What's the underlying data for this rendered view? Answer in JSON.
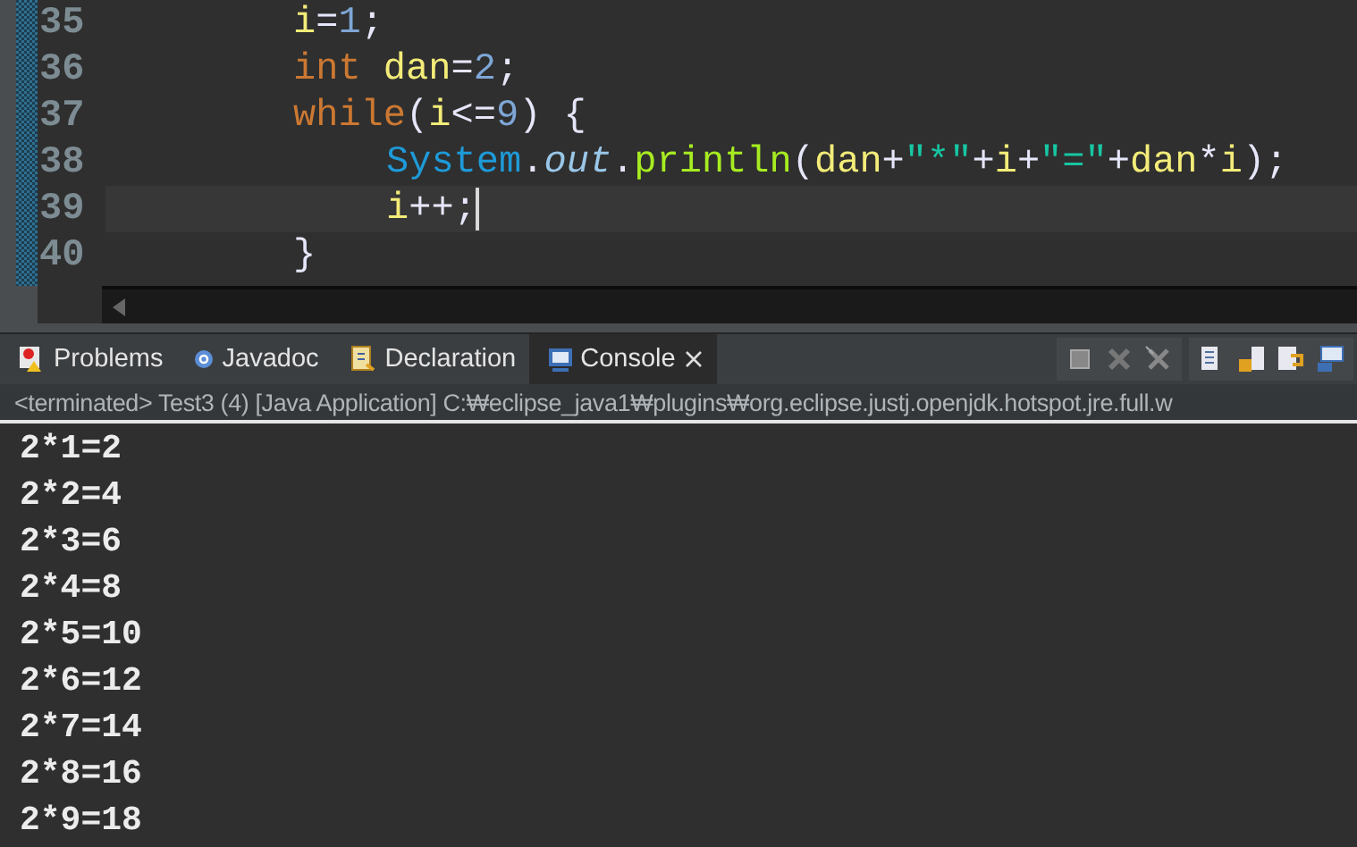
{
  "editor": {
    "lines": [
      {
        "number": "35",
        "current": false,
        "tokens": [
          {
            "text": "i",
            "kind": "var"
          },
          {
            "text": "=",
            "kind": "op"
          },
          {
            "text": "1",
            "kind": "number"
          },
          {
            "text": ";",
            "kind": "op"
          }
        ]
      },
      {
        "number": "36",
        "current": false,
        "tokens": [
          {
            "text": "int ",
            "kind": "keyword"
          },
          {
            "text": "dan",
            "kind": "var"
          },
          {
            "text": "=",
            "kind": "op"
          },
          {
            "text": "2",
            "kind": "number"
          },
          {
            "text": ";",
            "kind": "op"
          }
        ]
      },
      {
        "number": "37",
        "current": false,
        "tokens": [
          {
            "text": "while",
            "kind": "keyword"
          },
          {
            "text": "(",
            "kind": "op"
          },
          {
            "text": "i",
            "kind": "var"
          },
          {
            "text": "<=",
            "kind": "op"
          },
          {
            "text": "9",
            "kind": "number"
          },
          {
            "text": ") {",
            "kind": "op"
          }
        ],
        "children": [
          {
            "number": "38",
            "current": false,
            "tokens": [
              {
                "text": "System",
                "kind": "class"
              },
              {
                "text": ".",
                "kind": "op"
              },
              {
                "text": "out",
                "kind": "field"
              },
              {
                "text": ".",
                "kind": "op"
              },
              {
                "text": "println",
                "kind": "method"
              },
              {
                "text": "(",
                "kind": "op"
              },
              {
                "text": "dan",
                "kind": "var"
              },
              {
                "text": "+",
                "kind": "op"
              },
              {
                "text": "\"*\"",
                "kind": "string"
              },
              {
                "text": "+",
                "kind": "op"
              },
              {
                "text": "i",
                "kind": "var"
              },
              {
                "text": "+",
                "kind": "op"
              },
              {
                "text": "\"=\"",
                "kind": "string"
              },
              {
                "text": "+",
                "kind": "op"
              },
              {
                "text": "dan",
                "kind": "var"
              },
              {
                "text": "*",
                "kind": "op"
              },
              {
                "text": "i",
                "kind": "var"
              },
              {
                "text": ");",
                "kind": "op"
              }
            ]
          },
          {
            "number": "39",
            "current": true,
            "tokens": [
              {
                "text": "i",
                "kind": "var"
              },
              {
                "text": "++;",
                "kind": "op"
              }
            ]
          }
        ]
      },
      {
        "number": "40",
        "current": false,
        "tokens": [
          {
            "text": "}",
            "kind": "op"
          }
        ]
      }
    ]
  },
  "tabs": [
    {
      "label": "Problems",
      "kind": "problems",
      "selected": false
    },
    {
      "label": "Javadoc",
      "kind": "javadoc",
      "selected": false
    },
    {
      "label": "Declaration",
      "kind": "declaration",
      "selected": false
    },
    {
      "label": "Console",
      "kind": "console",
      "selected": true
    }
  ],
  "console": {
    "header": "<terminated> Test3 (4) [Java Application] C:₩eclipse_java1₩plugins₩org.eclipse.justj.openjdk.hotspot.jre.full.w",
    "output": [
      "2*1=2",
      "2*2=4",
      "2*3=6",
      "2*4=8",
      "2*5=10",
      "2*6=12",
      "2*7=14",
      "2*8=16",
      "2*9=18"
    ]
  }
}
